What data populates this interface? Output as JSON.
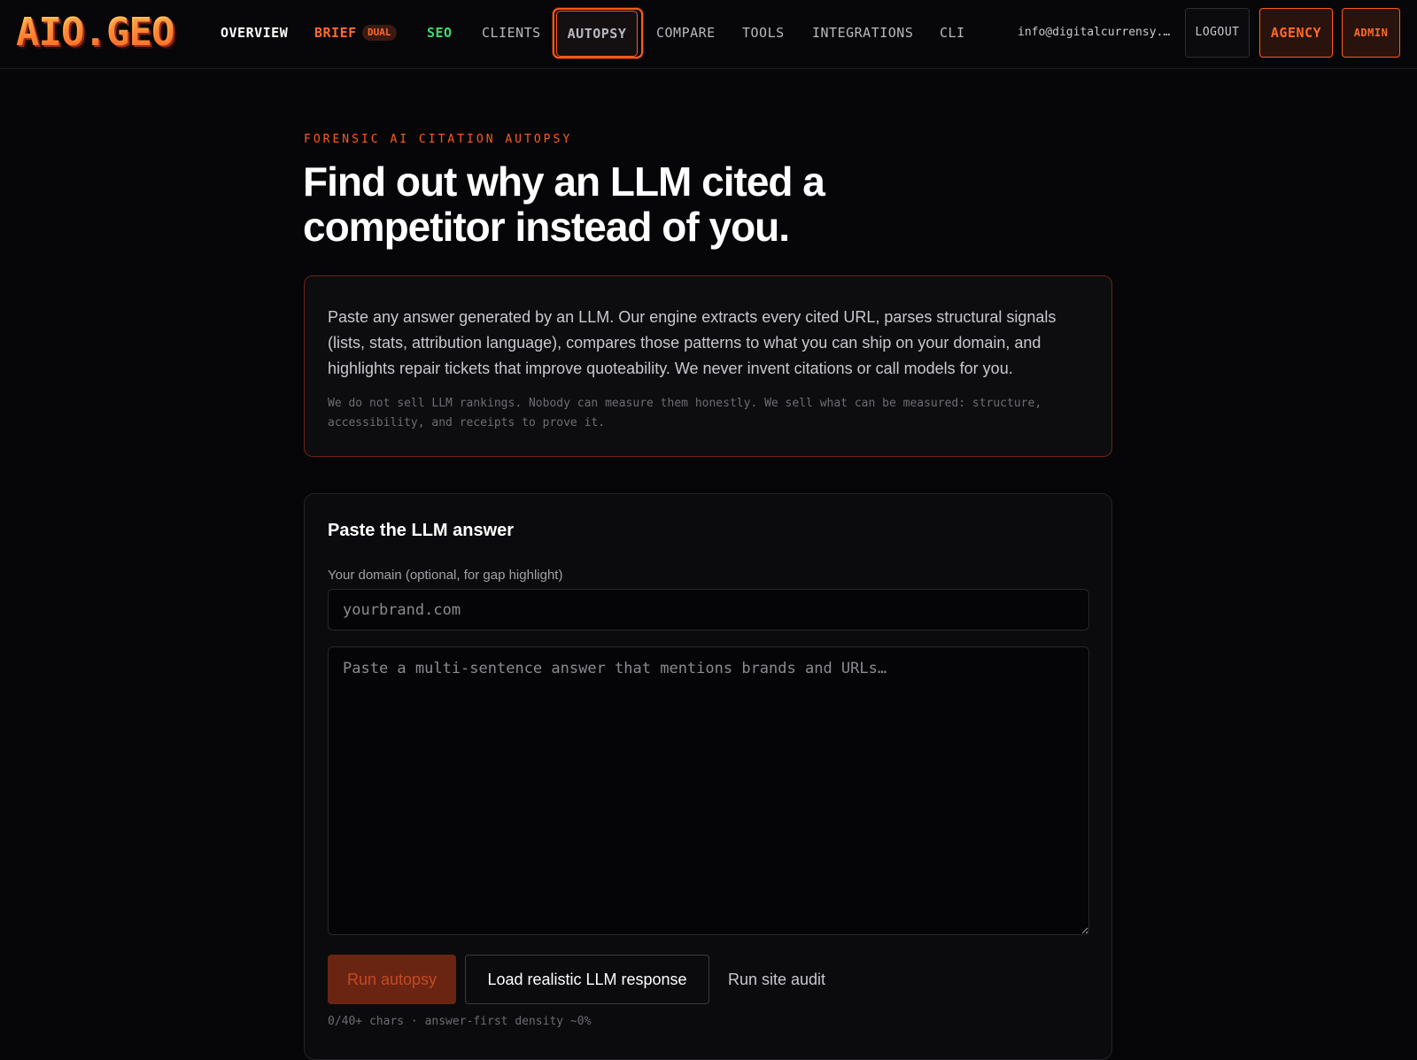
{
  "nav": {
    "logo": "AIO.GEO",
    "overview": "OVERVIEW",
    "brief": "BRIEF",
    "brief_badge": "DUAL",
    "seo": "SEO",
    "clients": "CLIENTS",
    "autopsy": "AUTOPSY",
    "compare": "COMPARE",
    "tools": "TOOLS",
    "integrations": "INTEGRATIONS",
    "cli": "CLI",
    "email": "info@digitalcurrensy.c…",
    "logout": "LOGOUT",
    "agency": "AGENCY",
    "admin": "ADMIN"
  },
  "hero": {
    "eyebrow": "FORENSIC AI CITATION AUTOPSY",
    "headline": "Find out why an LLM cited a competitor instead of you."
  },
  "intro": {
    "text": "Paste any answer generated by an LLM. Our engine extracts every cited URL, parses structural signals (lists, stats, attribution language), compares those patterns to what you can ship on your domain, and highlights repair tickets that improve quoteability. We never invent citations or call models for you.",
    "note": "We do not sell LLM rankings. Nobody can measure them honestly. We sell what can be measured: structure, accessibility, and receipts to prove it."
  },
  "form": {
    "title": "Paste the LLM answer",
    "domain_label": "Your domain (optional, for gap highlight)",
    "domain_value": "",
    "domain_placeholder": "yourbrand.com",
    "answer_value": "",
    "answer_placeholder": "Paste a multi-sentence answer that mentions brands and URLs…",
    "run_label": "Run autopsy",
    "load_label": "Load realistic LLM response",
    "audit_label": "Run site audit",
    "meta": "0/40+ chars · answer-first density ~0%"
  },
  "colors": {
    "accent": "#ff5a1a",
    "seo_green": "#3ddc6a",
    "background": "#060608"
  }
}
